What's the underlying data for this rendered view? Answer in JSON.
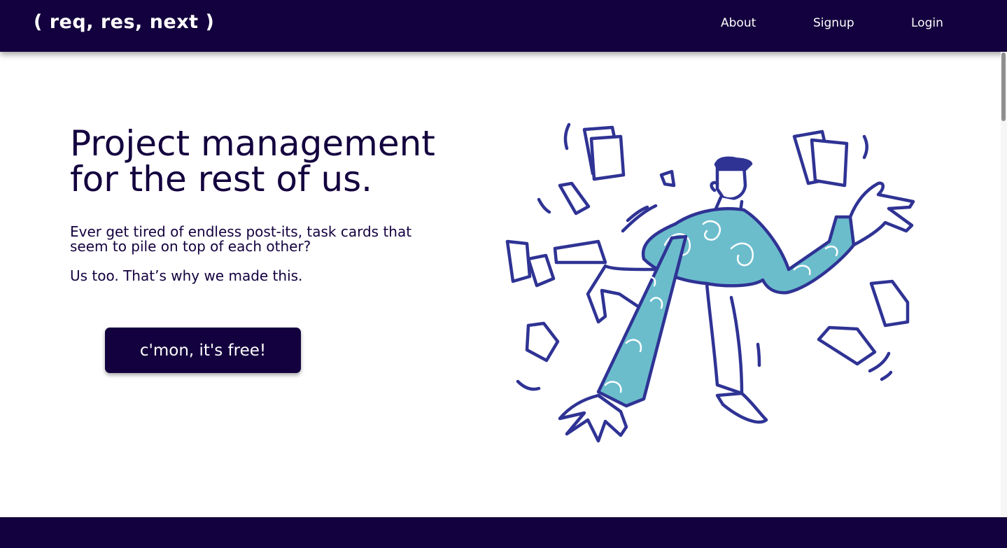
{
  "nav": {
    "brand": "( req, res, next )",
    "links": [
      {
        "label": "About"
      },
      {
        "label": "Signup"
      },
      {
        "label": "Login"
      }
    ]
  },
  "hero": {
    "title_line1": "Project management",
    "title_line2": "for the rest of us.",
    "paragraph1": "Ever get tired of endless post-its, task cards that seem to pile on top of each other?",
    "paragraph2": "Us too. That’s why we made this.",
    "cta_label": "c'mon, it's free!"
  },
  "illustration": {
    "icon": "juggling-papers-illustration"
  },
  "colors": {
    "brand_dark": "#13003e",
    "illustration_stroke": "#2f3394",
    "illustration_fill": "#6bbdcc",
    "background": "#ffffff"
  }
}
